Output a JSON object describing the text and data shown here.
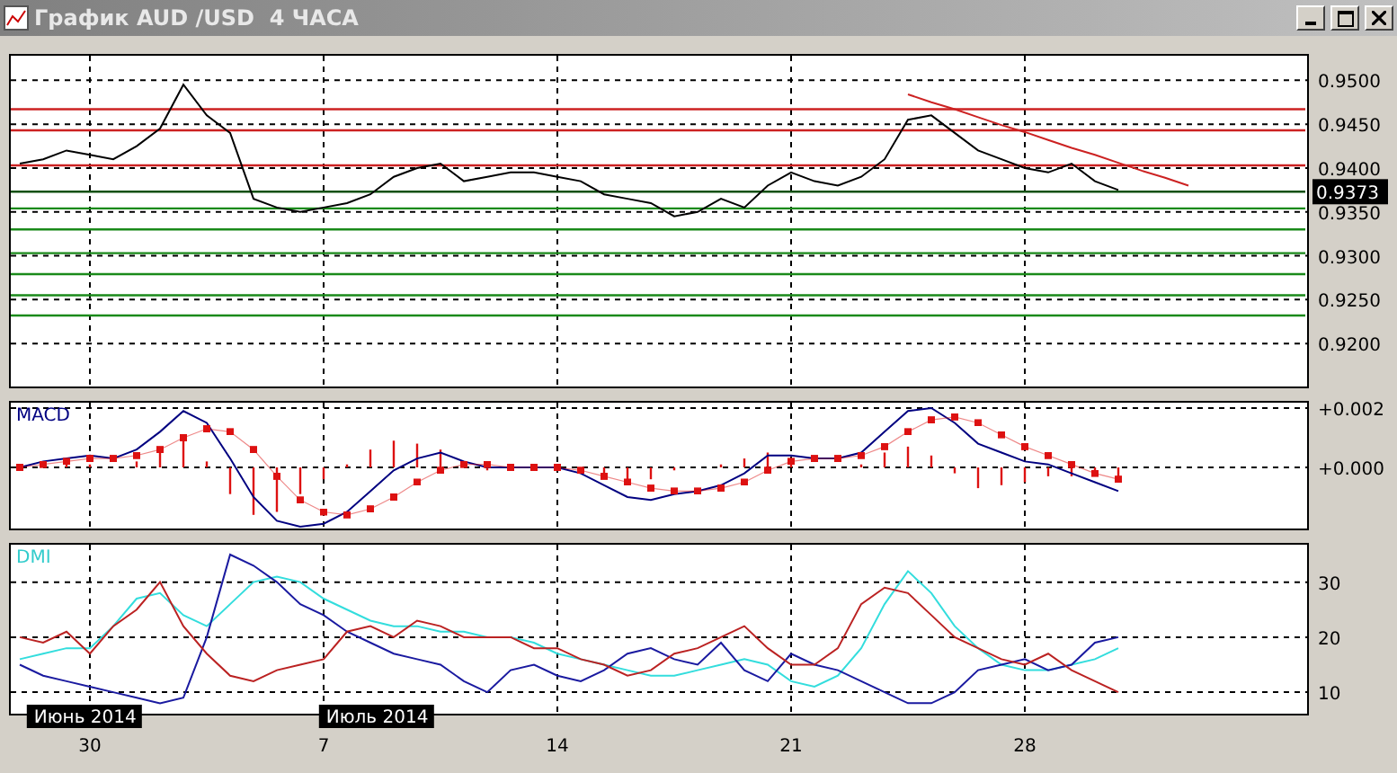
{
  "window": {
    "title": "График AUD /USD  4 ЧАСА"
  },
  "panels": [
    {
      "chart_data": {
        "type": "line",
        "grid": true,
        "ylim": [
          0.9151,
          0.9528
        ],
        "yticks": [
          {
            "value": 0.92,
            "label": "0.9200"
          },
          {
            "value": 0.925,
            "label": "0.9250"
          },
          {
            "value": 0.93,
            "label": "0.9300"
          },
          {
            "value": 0.935,
            "label": "0.9350"
          },
          {
            "value": 0.94,
            "label": "0.9400"
          },
          {
            "value": 0.945,
            "label": "0.9450"
          },
          {
            "value": 0.95,
            "label": "0.9500"
          }
        ],
        "series": [
          {
            "color": "#000000",
            "values": [
              0.9405,
              0.941,
              0.942,
              0.9415,
              0.941,
              0.9425,
              0.9445,
              0.9495,
              0.946,
              0.944,
              0.9365,
              0.9355,
              0.935,
              0.9355,
              0.936,
              0.937,
              0.939,
              0.94,
              0.9405,
              0.9385,
              0.939,
              0.9395,
              0.9395,
              0.939,
              0.9385,
              0.937,
              0.9365,
              0.936,
              0.9345,
              0.935,
              0.9365,
              0.9355,
              0.938,
              0.9395,
              0.9385,
              0.938,
              0.939,
              0.941,
              0.9455,
              0.946,
              0.944,
              0.942,
              0.941,
              0.94,
              0.9395,
              0.9405,
              0.9385,
              0.9375,
              null,
              null,
              null
            ]
          },
          {
            "color": "#cc2222",
            "values": [
              null,
              null,
              null,
              null,
              null,
              null,
              null,
              null,
              null,
              null,
              null,
              null,
              null,
              null,
              null,
              null,
              null,
              null,
              null,
              null,
              null,
              null,
              null,
              null,
              null,
              null,
              null,
              null,
              null,
              null,
              null,
              null,
              null,
              null,
              null,
              null,
              null,
              null,
              0.9484,
              0.9475,
              0.9467,
              0.9458,
              0.9449,
              0.9441,
              0.9432,
              0.9423,
              0.9415,
              0.9406,
              0.9397,
              0.9389,
              0.938
            ]
          }
        ],
        "ref_lines": [
          {
            "axis": "y",
            "value": 0.9467,
            "color": "#cc2222"
          },
          {
            "axis": "y",
            "value": 0.9443,
            "color": "#cc2222"
          },
          {
            "axis": "y",
            "value": 0.9403,
            "color": "#cc2222"
          },
          {
            "axis": "y",
            "value": 0.9373,
            "color": "#105010",
            "label": "0.9373"
          },
          {
            "axis": "y",
            "value": 0.9354,
            "color": "#1a8a1a"
          },
          {
            "axis": "y",
            "value": 0.933,
            "color": "#1a8a1a"
          },
          {
            "axis": "y",
            "value": 0.9303,
            "color": "#1a8a1a"
          },
          {
            "axis": "y",
            "value": 0.9279,
            "color": "#1a8a1a"
          },
          {
            "axis": "y",
            "value": 0.9255,
            "color": "#1a8a1a"
          },
          {
            "axis": "y",
            "value": 0.9232,
            "color": "#1a8a1a"
          }
        ]
      }
    },
    {
      "chart_data": {
        "type": "line",
        "title": "MACD",
        "grid": true,
        "ylim": [
          -0.00206,
          0.00218
        ],
        "yticks": [
          {
            "value": 0.0,
            "label": "+0.000"
          },
          {
            "value": 0.002,
            "label": "+0.002"
          }
        ],
        "series": [
          {
            "color": "#000080",
            "values": [
              0,
              0.0002,
              0.0003,
              0.0004,
              0.0003,
              0.0006,
              0.0012,
              0.0019,
              0.0015,
              0.0003,
              -0.001,
              -0.0018,
              -0.002,
              -0.0019,
              -0.0015,
              -0.0008,
              -0.0001,
              0.0003,
              0.0005,
              0.0002,
              0,
              0,
              0,
              0,
              -0.0002,
              -0.0006,
              -0.001,
              -0.0011,
              -0.0009,
              -0.0008,
              -0.0006,
              -0.0002,
              0.0004,
              0.0004,
              0.0003,
              0.0003,
              0.0005,
              0.0012,
              0.0019,
              0.002,
              0.0015,
              0.0008,
              0.0005,
              0.0002,
              0.0001,
              -0.0002,
              -0.0005,
              -0.0008,
              null,
              null,
              null
            ]
          },
          {
            "color": "#dd1111",
            "values": [
              0,
              0.0001,
              0.0002,
              0.0003,
              0.0003,
              0.0004,
              0.0006,
              0.001,
              0.0013,
              0.0012,
              0.0006,
              -0.0003,
              -0.0011,
              -0.0015,
              -0.0016,
              -0.0014,
              -0.001,
              -0.0005,
              -0.0001,
              0.0001,
              0.0001,
              0,
              0,
              0,
              -0.0001,
              -0.0003,
              -0.0005,
              -0.0007,
              -0.0008,
              -0.0008,
              -0.0007,
              -0.0005,
              -0.0001,
              0.0002,
              0.0003,
              0.0003,
              0.0004,
              0.0007,
              0.0012,
              0.0016,
              0.0017,
              0.0015,
              0.0011,
              0.0007,
              0.0004,
              0.0001,
              -0.0002,
              -0.0004,
              null,
              null,
              null
            ]
          }
        ]
      }
    },
    {
      "chart_data": {
        "type": "line",
        "title": "DMI",
        "grid": true,
        "ylim": [
          6.1,
          36.8
        ],
        "yticks": [
          {
            "value": 10,
            "label": "10"
          },
          {
            "value": 20,
            "label": "20"
          },
          {
            "value": 30,
            "label": "30"
          }
        ],
        "series": [
          {
            "color": "#33dddd",
            "values": [
              16,
              17,
              18,
              18,
              22,
              27,
              28,
              24,
              22,
              26,
              30,
              31,
              30,
              27,
              25,
              23,
              22,
              22,
              21,
              21,
              20,
              20,
              19,
              17,
              16,
              15,
              14,
              13,
              13,
              14,
              15,
              16,
              15,
              12,
              11,
              13,
              18,
              26,
              32,
              28,
              22,
              18,
              15,
              14,
              14,
              15,
              16,
              18,
              null,
              null,
              null
            ]
          },
          {
            "color": "#1a1aa0",
            "values": [
              15,
              13,
              12,
              11,
              10,
              9,
              8,
              9,
              20,
              35,
              33,
              30,
              26,
              24,
              21,
              19,
              17,
              16,
              15,
              12,
              10,
              14,
              15,
              13,
              12,
              14,
              17,
              18,
              16,
              15,
              19,
              14,
              12,
              17,
              15,
              14,
              12,
              10,
              8,
              8,
              10,
              14,
              15,
              16,
              14,
              15,
              19,
              20,
              null,
              null,
              null
            ]
          },
          {
            "color": "#bb2222",
            "values": [
              20,
              19,
              21,
              17,
              22,
              25,
              30,
              22,
              17,
              13,
              12,
              14,
              15,
              16,
              21,
              22,
              20,
              23,
              22,
              20,
              20,
              20,
              18,
              18,
              16,
              15,
              13,
              14,
              17,
              18,
              20,
              22,
              18,
              15,
              15,
              18,
              26,
              29,
              28,
              24,
              20,
              18,
              16,
              15,
              17,
              14,
              12,
              10,
              null,
              null,
              null
            ]
          }
        ]
      }
    }
  ],
  "time_axis": {
    "months": [
      "Июнь 2014",
      "Июль 2014"
    ],
    "days": [
      "30",
      "7",
      "14",
      "21",
      "28"
    ]
  }
}
